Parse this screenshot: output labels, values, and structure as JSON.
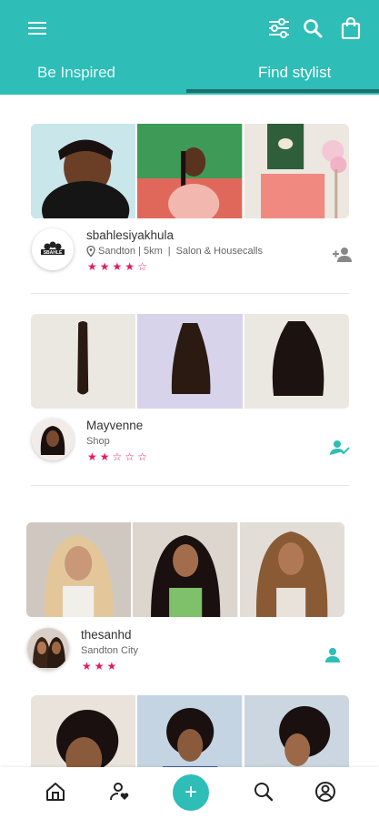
{
  "header": {
    "tabs": [
      {
        "label": "Be Inspired",
        "active": false
      },
      {
        "label": "Find stylist",
        "active": true
      }
    ],
    "icons": [
      "menu-icon",
      "filter-sliders-icon",
      "search-icon",
      "shopping-bag-icon"
    ]
  },
  "colors": {
    "accent": "#2ebdb7",
    "tab_indicator": "#1e6f6a",
    "star": "#e5185f"
  },
  "stylists": [
    {
      "name": "sbahlesiyakhula",
      "location_line": "Sandton | 5km",
      "separator": "|",
      "service": "Salon & Housecalls",
      "has_location_icon": true,
      "rating": 4,
      "rating_max": 5,
      "avatar_logo_text": "SBAHLE",
      "follow_icon": "add-person-icon"
    },
    {
      "name": "Mayvenne",
      "subtitle": "Shop",
      "rating": 2,
      "rating_max": 5,
      "follow_icon": "following-check-icon"
    },
    {
      "name": "thesanhd",
      "subtitle": "Sandton City",
      "rating": 3,
      "rating_max": 3,
      "follow_icon": "person-icon"
    }
  ],
  "bottom_nav": [
    {
      "icon": "home-icon"
    },
    {
      "icon": "person-heart-icon"
    },
    {
      "icon": "add-icon",
      "glyph": "+"
    },
    {
      "icon": "search-icon"
    },
    {
      "icon": "account-icon"
    }
  ]
}
